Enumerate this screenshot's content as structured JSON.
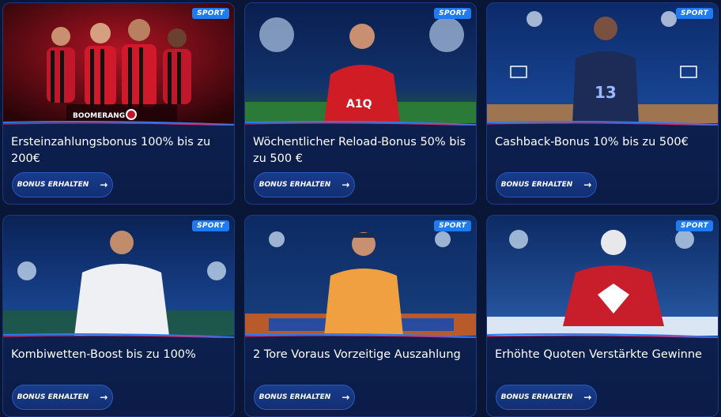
{
  "badge_label": "SPORT",
  "button_label": "BONUS ERHALTEN",
  "arrow_icon": "arrow-right-icon",
  "colors": {
    "accent": "#1e7cf0",
    "card_bg": "#0f2456",
    "page_bg": "#0a1636"
  },
  "cards": [
    {
      "title": "Ersteinzahlungsbonus 100% bis zu 200€",
      "image": "football-team-players",
      "logo_text": "BOOMERANG"
    },
    {
      "title": "Wöchentlicher Reload-Bonus 50% bis zu 500 €",
      "image": "football-player-cheering"
    },
    {
      "title": "Cashback-Bonus 10% bis zu 500€",
      "image": "basketball-player"
    },
    {
      "title": "Kombiwetten-Boost bis zu 100%",
      "image": "football-player-white-shirt"
    },
    {
      "title": "2 Tore Voraus Vorzeitige Auszahlung",
      "image": "tennis-player"
    },
    {
      "title": "Erhöhte Quoten Verstärkte Gewinne",
      "image": "hockey-player"
    }
  ]
}
